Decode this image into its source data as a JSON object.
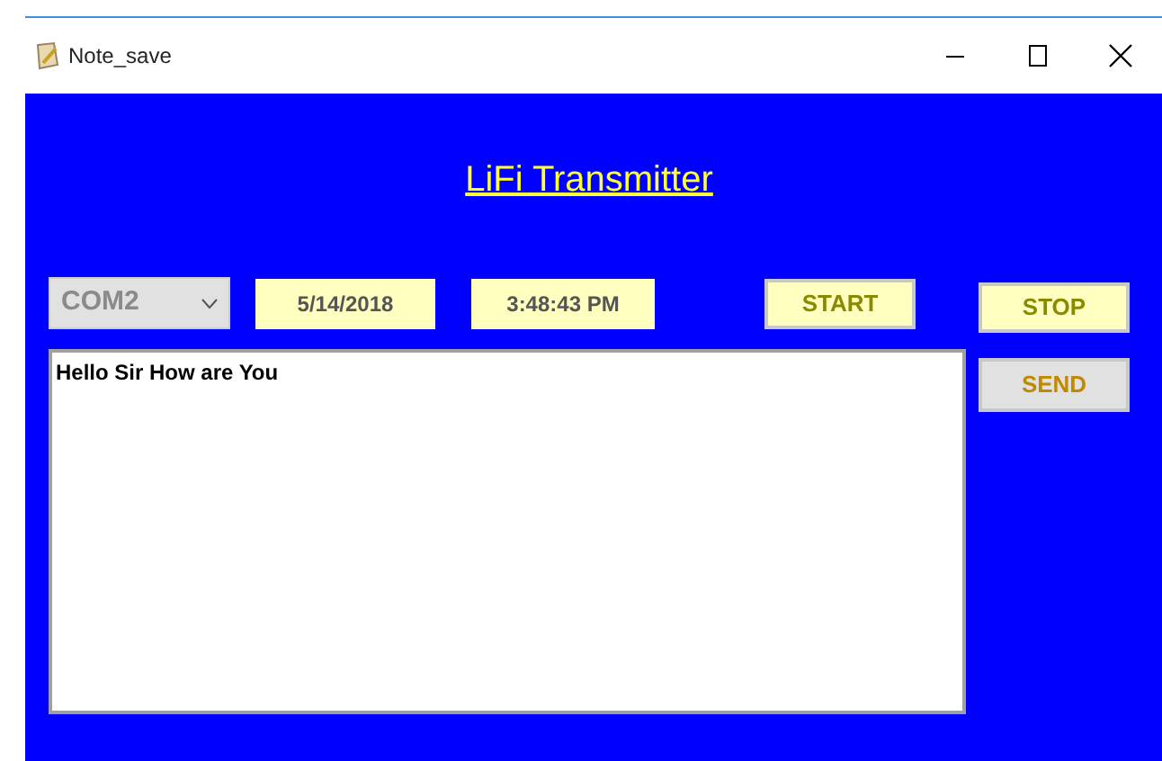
{
  "window": {
    "title": "Note_save"
  },
  "heading": "LiFi Transmitter",
  "port_select": {
    "value": "COM2",
    "disabled": true
  },
  "date": "5/14/2018",
  "time": "3:48:43 PM",
  "buttons": [
    {
      "label": "START",
      "highlighted": true
    },
    {
      "label": "STOP",
      "highlighted": true
    },
    {
      "label": "SEND",
      "highlighted": false
    }
  ],
  "message": {
    "value": "Hello Sir How are You"
  }
}
